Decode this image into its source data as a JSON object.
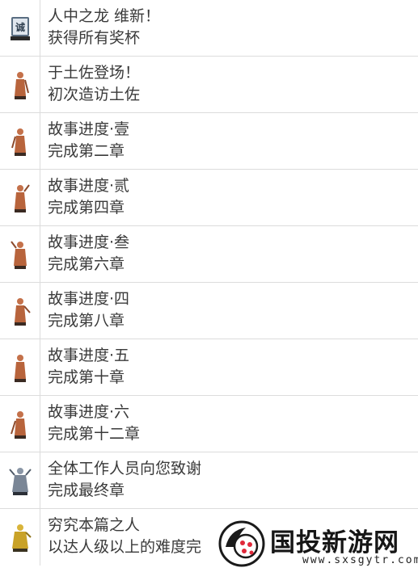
{
  "achievements": [
    {
      "title": "人中之龙 维新！",
      "desc": "获得所有奖杯",
      "trophy": "seal-trophy-icon"
    },
    {
      "title": "于土佐登场！",
      "desc": "初次造访土佐",
      "trophy": "bronze-samurai-icon"
    },
    {
      "title": "故事进度·壹",
      "desc": "完成第二章",
      "trophy": "bronze-samurai-icon"
    },
    {
      "title": "故事进度·贰",
      "desc": "完成第四章",
      "trophy": "bronze-samurai-icon"
    },
    {
      "title": "故事进度·叁",
      "desc": "完成第六章",
      "trophy": "bronze-samurai-icon"
    },
    {
      "title": "故事进度·四",
      "desc": "完成第八章",
      "trophy": "bronze-samurai-icon"
    },
    {
      "title": "故事进度·五",
      "desc": "完成第十章",
      "trophy": "bronze-samurai-icon"
    },
    {
      "title": "故事进度·六",
      "desc": "完成第十二章",
      "trophy": "bronze-samurai-icon"
    },
    {
      "title": "全体工作人员向您致谢",
      "desc": "完成最终章",
      "trophy": "silver-samurai-icon"
    },
    {
      "title": "穷究本篇之人",
      "desc": "以达人级以上的难度完",
      "trophy": "gold-samurai-icon"
    }
  ],
  "watermark": {
    "title": "国投新游网",
    "url": "www.sxsgytr.com"
  },
  "colors": {
    "bronze": "#c4714a",
    "silver": "#8a96a6",
    "gold": "#c9a227",
    "border": "#dcdcdc"
  }
}
